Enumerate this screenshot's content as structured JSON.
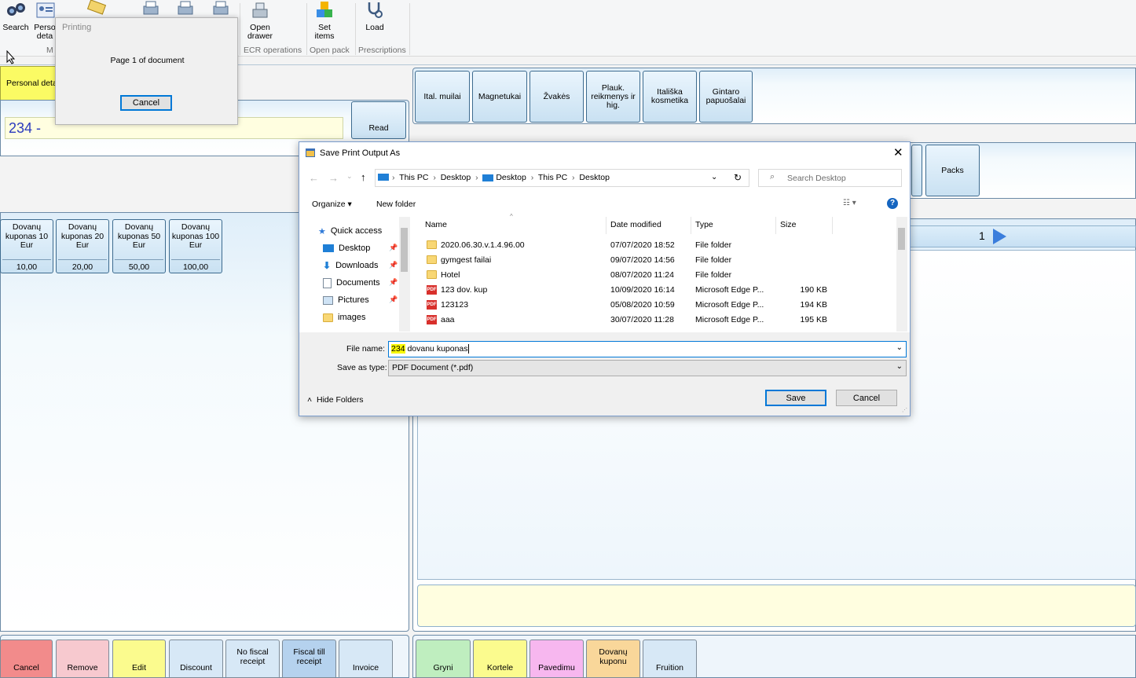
{
  "ribbon": {
    "buttons": [
      {
        "label": "Search",
        "icon": "binoculars-icon"
      },
      {
        "label": "Perso deta",
        "icon": "person-card-icon"
      },
      {
        "label": "",
        "icon": "ticket-icon"
      },
      {
        "label": "",
        "icon": "printer-icon"
      },
      {
        "label": "",
        "icon": "printer-icon"
      },
      {
        "label": "",
        "icon": "printer-icon"
      },
      {
        "label": "Open drawer",
        "icon": "cash-register-icon"
      },
      {
        "label": "Set items",
        "icon": "boxes-icon"
      },
      {
        "label": "Load",
        "icon": "stethoscope-icon"
      }
    ],
    "groups": [
      "M",
      "ECR operations",
      "Open pack",
      "Prescriptions"
    ]
  },
  "printing_dialog": {
    "title": "Printing",
    "message": "Page 1 of document",
    "cancel": "Cancel"
  },
  "left": {
    "personal_tab": "Personal deta",
    "input_value": "234 -",
    "read_button": "Read",
    "vouchers": [
      {
        "line1": "Dovanų",
        "line2": "kuponas 10",
        "line3": "Eur",
        "price": "10,00"
      },
      {
        "line1": "Dovanų",
        "line2": "kuponas 20",
        "line3": "Eur",
        "price": "20,00"
      },
      {
        "line1": "Dovanų",
        "line2": "kuponas 50",
        "line3": "Eur",
        "price": "50,00"
      },
      {
        "line1": "Dovanų",
        "line2": "kuponas 100",
        "line3": "Eur",
        "price": "100,00"
      }
    ]
  },
  "right": {
    "categories": [
      {
        "l1": "Ital. muilai",
        "l2": "",
        "l3": ""
      },
      {
        "l1": "Magnetukai",
        "l2": "",
        "l3": ""
      },
      {
        "l1": "Žvakės",
        "l2": "",
        "l3": ""
      },
      {
        "l1": "Plauk.",
        "l2": "reikmenys ir",
        "l3": "hig."
      },
      {
        "l1": "Itališka",
        "l2": "kosmetika",
        "l3": ""
      },
      {
        "l1": "Gintaro",
        "l2": "papuošalai",
        "l3": ""
      }
    ],
    "packs": "Packs",
    "page_number": "1"
  },
  "bottom_left": [
    {
      "l1": "Cancel",
      "l2": "",
      "color": "#f28b8b"
    },
    {
      "l1": "Remove",
      "l2": "",
      "color": "#f7c9cf"
    },
    {
      "l1": "Edit",
      "l2": "",
      "color": "#fbfb8e"
    },
    {
      "l1": "Discount",
      "l2": "",
      "color": "#d7e8f6"
    },
    {
      "l1": "No fiscal",
      "l2": "receipt",
      "color": "#d7e8f6"
    },
    {
      "l1": "Fiscal till",
      "l2": "receipt",
      "color": "#b5d2ee"
    },
    {
      "l1": "Invoice",
      "l2": "",
      "color": "#d7e8f6"
    }
  ],
  "bottom_right": [
    {
      "l1": "Gryni",
      "l2": "",
      "color": "#bfeebf"
    },
    {
      "l1": "Kortele",
      "l2": "",
      "color": "#fbfb8e"
    },
    {
      "l1": "Pavedimu",
      "l2": "",
      "color": "#f7b7ef"
    },
    {
      "l1": "Dovanų",
      "l2": "kuponu",
      "color": "#f9d79a"
    },
    {
      "l1": "Fruition",
      "l2": "",
      "color": "#d7e8f6"
    }
  ],
  "save_dialog": {
    "title": "Save Print Output As",
    "breadcrumb": [
      "This PC",
      "Desktop",
      "Desktop",
      "This PC",
      "Desktop"
    ],
    "search_placeholder": "Search Desktop",
    "organize": "Organize ▾",
    "new_folder": "New folder",
    "nav": [
      {
        "label": "Quick access",
        "icon": "star-icon",
        "pin": false
      },
      {
        "label": "Desktop",
        "icon": "desktop-icon",
        "pin": true
      },
      {
        "label": "Downloads",
        "icon": "download-icon",
        "pin": true
      },
      {
        "label": "Documents",
        "icon": "documents-icon",
        "pin": true
      },
      {
        "label": "Pictures",
        "icon": "pictures-icon",
        "pin": true
      },
      {
        "label": "images",
        "icon": "folder-icon",
        "pin": false
      }
    ],
    "columns": {
      "name": "Name",
      "date": "Date modified",
      "type": "Type",
      "size": "Size"
    },
    "files": [
      {
        "name": "2020.06.30.v.1.4.96.00",
        "date": "07/07/2020 18:52",
        "type": "File folder",
        "size": "",
        "kind": "folder"
      },
      {
        "name": "gymgest failai",
        "date": "09/07/2020 14:56",
        "type": "File folder",
        "size": "",
        "kind": "folder"
      },
      {
        "name": "Hotel",
        "date": "08/07/2020 11:24",
        "type": "File folder",
        "size": "",
        "kind": "folder"
      },
      {
        "name": "123 dov. kup",
        "date": "10/09/2020 16:14",
        "type": "Microsoft Edge P...",
        "size": "190 KB",
        "kind": "pdf"
      },
      {
        "name": "123123",
        "date": "05/08/2020 10:59",
        "type": "Microsoft Edge P...",
        "size": "194 KB",
        "kind": "pdf"
      },
      {
        "name": "aaa",
        "date": "30/07/2020 11:28",
        "type": "Microsoft Edge P...",
        "size": "195 KB",
        "kind": "pdf"
      }
    ],
    "file_name_label": "File name:",
    "file_name_highlight": "234",
    "file_name_rest": " dovanu kuponas",
    "save_type_label": "Save as type:",
    "save_type_value": "PDF Document (*.pdf)",
    "hide_folders": "Hide Folders",
    "save": "Save",
    "cancel": "Cancel"
  }
}
